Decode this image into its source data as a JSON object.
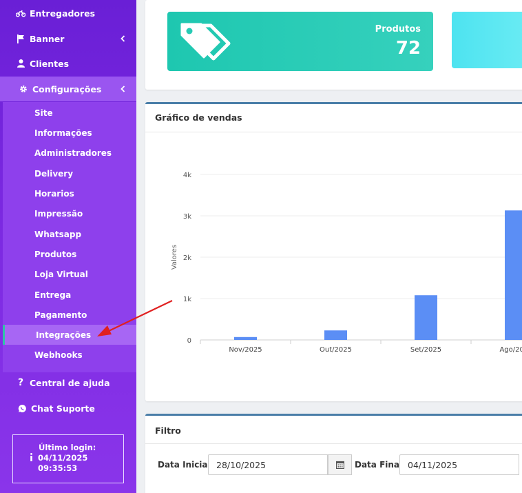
{
  "sidebar": {
    "items": [
      {
        "label": "Entregadores",
        "icon": "motorcycle-icon"
      },
      {
        "label": "Banner",
        "icon": "flag-icon"
      },
      {
        "label": "Clientes",
        "icon": "user-icon"
      },
      {
        "label": "Configurações",
        "icon": "gear-icon"
      }
    ],
    "submenu": [
      "Site",
      "Informações",
      "Administradores",
      "Delivery",
      "Horarios",
      "Impressão",
      "Whatsapp",
      "Produtos",
      "Loja Virtual",
      "Entrega",
      "Pagamento",
      "Integrações",
      "Webhooks"
    ],
    "bottom": [
      {
        "label": "Central de ajuda",
        "icon": "question-icon"
      },
      {
        "label": "Chat Suporte",
        "icon": "whatsapp-icon"
      }
    ],
    "login": {
      "title": "Último login:",
      "date": "04/11/2025",
      "time": "09:35:53"
    }
  },
  "stats": {
    "label": "Produtos",
    "value": "72"
  },
  "chart_panel": {
    "title": "Gráfico de vendas"
  },
  "chart_data": {
    "type": "bar",
    "categories": [
      "Nov/2025",
      "Out/2025",
      "Set/2025",
      "Ago/2025"
    ],
    "values": [
      70,
      230,
      1080,
      3130
    ],
    "ylabel": "Valores",
    "ylim": [
      0,
      4000
    ],
    "yticks": [
      "0",
      "1k",
      "2k",
      "3k",
      "4k"
    ],
    "color": "#5b8ef5"
  },
  "filter": {
    "title": "Filtro",
    "start_label": "Data Inicial:",
    "start_value": "28/10/2025",
    "end_label": "Data Final:",
    "end_value": "04/11/2025"
  },
  "colors": {
    "accent_teal": "#1ec7b0",
    "sidebar": "#7a28e0",
    "annotation_arrow": "#e02020"
  }
}
